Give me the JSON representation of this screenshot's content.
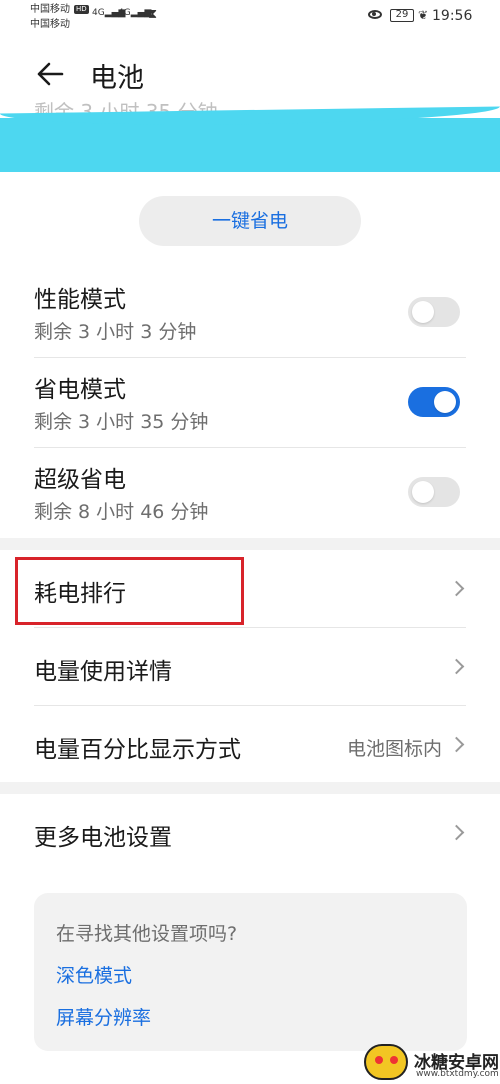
{
  "status_bar": {
    "carrier_1": "中国移动",
    "carrier_2": "中国移动",
    "hd": "HD",
    "signal_1": "4G",
    "signal_2": "4G",
    "battery_level": "29",
    "time": "19:56"
  },
  "header": {
    "title": "电池"
  },
  "cutoff_text": "剩余 3 小时 35 分钟",
  "onekey_button": "一键省电",
  "modes": [
    {
      "title": "性能模式",
      "subtitle": "剩余 3 小时 3 分钟",
      "enabled": false
    },
    {
      "title": "省电模式",
      "subtitle": "剩余 3 小时 35 分钟",
      "enabled": true
    },
    {
      "title": "超级省电",
      "subtitle": "剩余 8 小时 46 分钟",
      "enabled": false
    }
  ],
  "list": [
    {
      "label": "耗电排行",
      "value": ""
    },
    {
      "label": "电量使用详情",
      "value": ""
    },
    {
      "label": "电量百分比显示方式",
      "value": "电池图标内"
    }
  ],
  "more_settings": "更多电池设置",
  "suggest": {
    "title": "在寻找其他设置项吗?",
    "links": [
      "深色模式",
      "屏幕分辨率"
    ]
  },
  "watermark": {
    "name": "冰糖安卓网",
    "url": "www.btxtdmy.com"
  },
  "colors": {
    "accent": "#1a6fe0",
    "highlight": "#d8232a",
    "cyan_band": "#4dd7f0"
  }
}
